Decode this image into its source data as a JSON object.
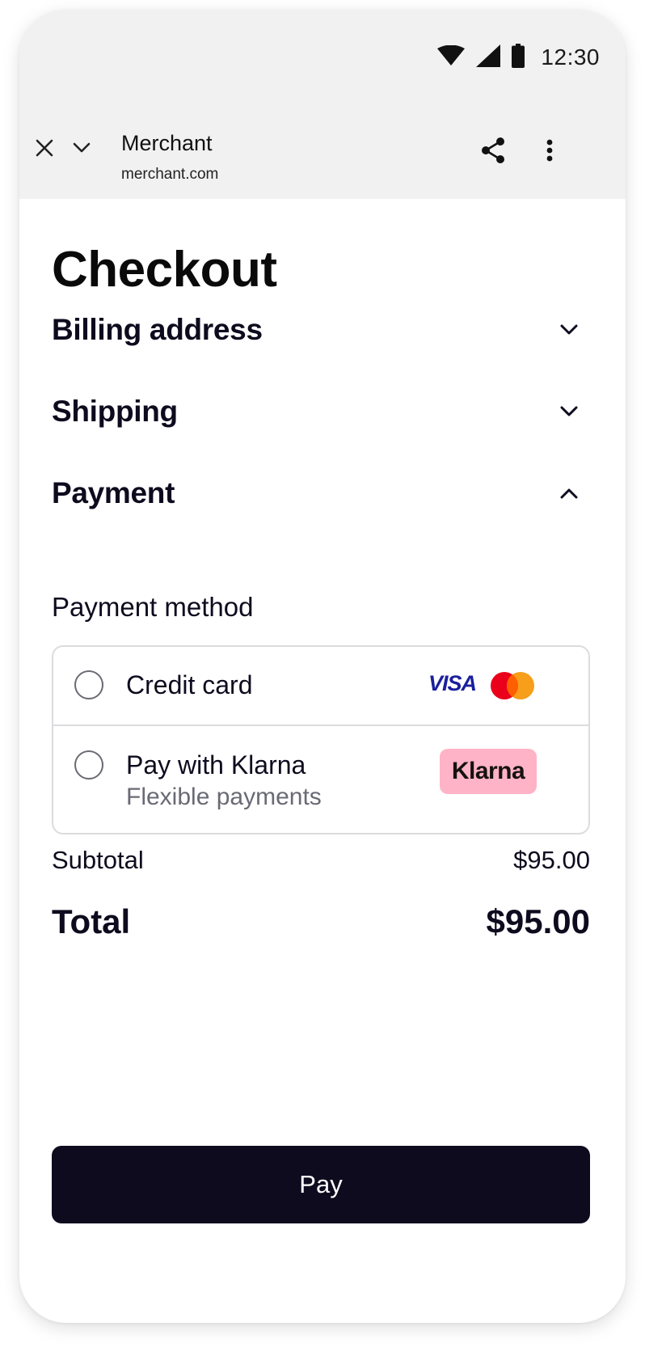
{
  "status_bar": {
    "time": "12:30",
    "icons": [
      "wifi-icon",
      "cellular-signal-icon",
      "battery-icon"
    ]
  },
  "browser_toolbar": {
    "title": "Merchant",
    "url": "merchant.com",
    "icons": [
      "close-icon",
      "chevron-down-icon",
      "share-icon",
      "more-vert-icon"
    ]
  },
  "page": {
    "title": "Checkout"
  },
  "sections": {
    "billing": {
      "label": "Billing address",
      "expanded": false
    },
    "shipping": {
      "label": "Shipping",
      "expanded": false
    },
    "payment": {
      "label": "Payment",
      "expanded": true
    }
  },
  "payment": {
    "method_label": "Payment method",
    "options": [
      {
        "label": "Credit card",
        "selected": false,
        "brand_logos": [
          "VISA",
          "mastercard"
        ]
      },
      {
        "label": "Pay with Klarna",
        "sublabel": "Flexible payments",
        "selected": false,
        "badge": "Klarna"
      }
    ]
  },
  "summary": {
    "subtotal_label": "Subtotal",
    "subtotal_value": "$95.00",
    "total_label": "Total",
    "total_value": "$95.00"
  },
  "pay_button": {
    "label": "Pay"
  },
  "colors": {
    "primary": "#0e0b1e",
    "klarna_pink": "#ffb3c7",
    "visa_blue": "#1a1f9e",
    "mastercard_red": "#eb001b",
    "mastercard_orange": "#f79e1b",
    "chrome_bg": "#f1f1f1",
    "border": "#dcdcdf",
    "muted_text": "#6a6a75"
  }
}
